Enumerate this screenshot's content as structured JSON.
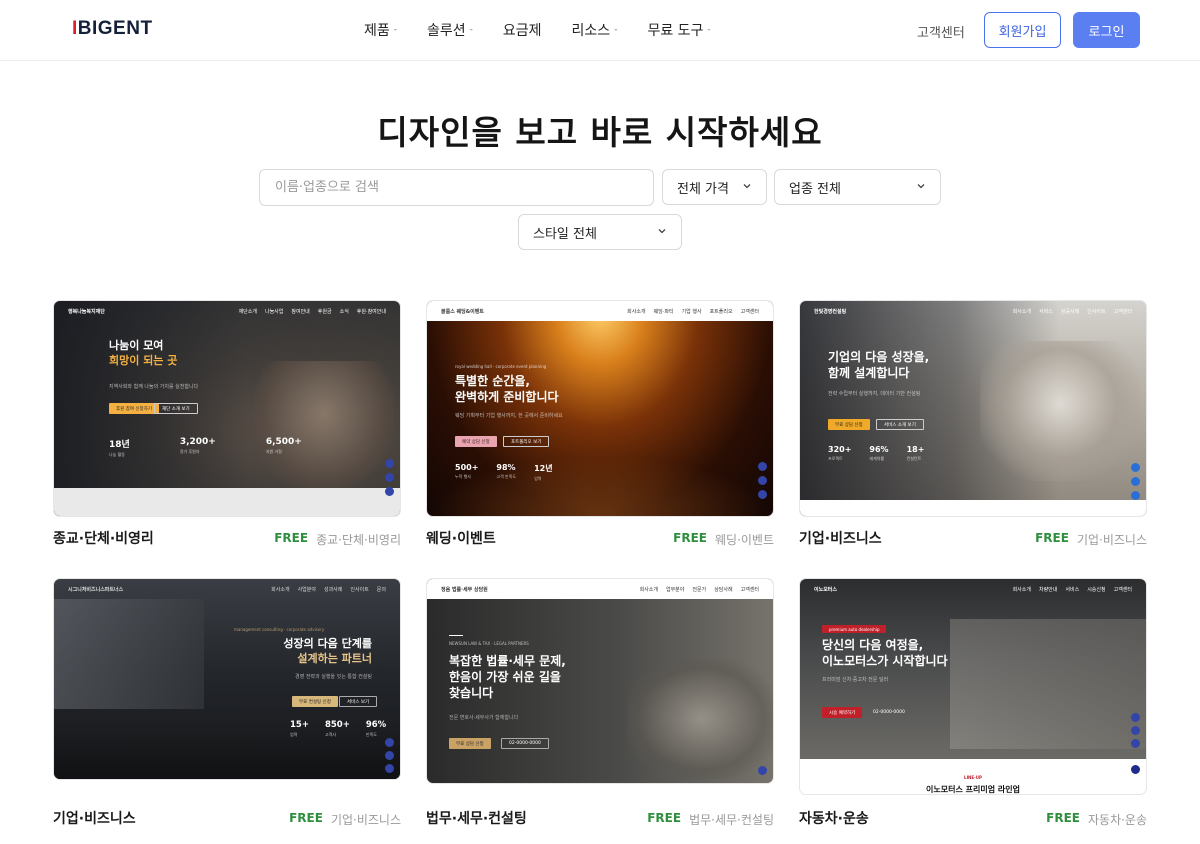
{
  "header": {
    "logo_accent": "I",
    "logo_rest": "BIGENT",
    "nav": [
      {
        "label": "제품",
        "caret": "-"
      },
      {
        "label": "솔루션",
        "caret": "-"
      },
      {
        "label": "요금제",
        "caret": ""
      },
      {
        "label": "리소스",
        "caret": "-"
      },
      {
        "label": "무료 도구",
        "caret": "-"
      }
    ],
    "support": "고객센터",
    "signup": "회원가입",
    "login": "로그인"
  },
  "hero": {
    "title": "디자인을 보고 바로 시작하세요",
    "search_placeholder": "이름·업종으로 검색",
    "price_select": "전체 가격",
    "industry_select": "업종 전체",
    "style_select": "스타일 전체"
  },
  "colors": {
    "accent_blue": "#5b7ff0",
    "free_green": "#2f8f3f",
    "logo_red": "#e11d2e"
  },
  "cards": [
    {
      "title": "종교·단체·비영리",
      "badge": "FREE",
      "category": "종교·단체·비영리",
      "thumb": {
        "logo": "행복나눔복지재단",
        "links": [
          "재단소개",
          "나눔사업",
          "참여안내",
          "후원금",
          "소식",
          "후원·참여안내"
        ],
        "headline1": "나눔이 모여",
        "headline2": "희망이 되는 곳",
        "sub": "지역사회와 함께 나눔의 가치를 실천합니다",
        "btn1": "후원 참여 신청하기",
        "btn2": "재단 소개 보기",
        "stats": [
          {
            "v": "18년",
            "l": "나눔 활동"
          },
          {
            "v": "3,200+",
            "l": "정기 후원자"
          },
          {
            "v": "6,500+",
            "l": "지원 가정"
          }
        ]
      }
    },
    {
      "title": "웨딩·이벤트",
      "badge": "FREE",
      "category": "웨딩·이벤트",
      "thumb": {
        "logo": "블룸스 웨딩&이벤트",
        "links": [
          "회사소개",
          "웨딩·파티",
          "기업 행사",
          "포트폴리오",
          "고객센터"
        ],
        "eyebrow": "royal wedding hall · corporate event planning",
        "headline1": "특별한 순간을,",
        "headline2": "완벽하게 준비합니다",
        "sub": "웨딩 기획부터 기업 행사까지, 한 곳에서 준비하세요",
        "btn1": "예약 상담 신청",
        "btn2": "포트폴리오 보기",
        "stats": [
          {
            "v": "500+",
            "l": "누적 행사"
          },
          {
            "v": "98%",
            "l": "고객 만족도"
          },
          {
            "v": "12년",
            "l": "업력"
          }
        ]
      }
    },
    {
      "title": "기업·비즈니스",
      "badge": "FREE",
      "category": "기업·비즈니스",
      "thumb": {
        "logo": "한빛경영컨설팅",
        "links": [
          "회사소개",
          "서비스",
          "성공사례",
          "인사이트",
          "고객센터"
        ],
        "headline1": "기업의 다음 성장을,",
        "headline2": "함께 설계합니다",
        "sub": "전략 수립부터 실행까지, 데이터 기반 컨설팅",
        "btn1": "무료 상담 신청",
        "btn2": "서비스 소개 보기",
        "stats": [
          {
            "v": "320+",
            "l": "프로젝트"
          },
          {
            "v": "96%",
            "l": "재계약률"
          },
          {
            "v": "18+",
            "l": "컨설턴트"
          }
        ]
      }
    },
    {
      "title": "기업·비즈니스",
      "badge": "FREE",
      "category": "기업·비즈니스",
      "thumb": {
        "logo": "시그니처비즈니스파트너스",
        "links": [
          "회사소개",
          "사업분야",
          "성과사례",
          "인사이트",
          "문의"
        ],
        "eyebrow": "management consulting · corporate advisory",
        "headline1": "성장의 다음 단계를",
        "headline2": "설계하는 파트너",
        "sub": "경영 전략과 실행을 잇는 통합 컨설팅",
        "btn1": "무료 컨설팅 신청",
        "btn2": "서비스 보기",
        "stats": [
          {
            "v": "15+",
            "l": "업력"
          },
          {
            "v": "850+",
            "l": "고객사"
          },
          {
            "v": "96%",
            "l": "만족도"
          }
        ]
      }
    },
    {
      "title": "법무·세무·컨설팅",
      "badge": "FREE",
      "category": "법무·세무·컨설팅",
      "thumb": {
        "logo": "정음 법률·세무 상담원",
        "links": [
          "회사소개",
          "업무분야",
          "전문가",
          "상담사례",
          "고객센터"
        ],
        "eyebrow": "NEWSUN LAW & TAX · LEGAL PARTNERS",
        "headline1": "복잡한 법률·세무 문제,",
        "headline2": "한음이 가장 쉬운 길을",
        "headline3": "찾습니다",
        "sub": "전문 변호사·세무사가 함께합니다",
        "btn1": "무료 상담 신청",
        "btn2": "02-0000-0000"
      }
    },
    {
      "title": "자동차·운송",
      "badge": "FREE",
      "category": "자동차·운송",
      "thumb": {
        "logo": "이노모터스",
        "links": [
          "회사소개",
          "차량안내",
          "서비스",
          "시승신청",
          "고객센터"
        ],
        "eyebrow": "premium auto dealership",
        "headline1": "당신의 다음 여정을,",
        "headline2": "이노모터스가 시작합니다",
        "sub": "프리미엄 신차·중고차 전문 딜러",
        "btn1": "시승 예약하기",
        "btn2": "02-0000-0000",
        "footer_tag": "LINE-UP",
        "footer_title": "이노모터스 프리미엄 라인업"
      }
    }
  ]
}
